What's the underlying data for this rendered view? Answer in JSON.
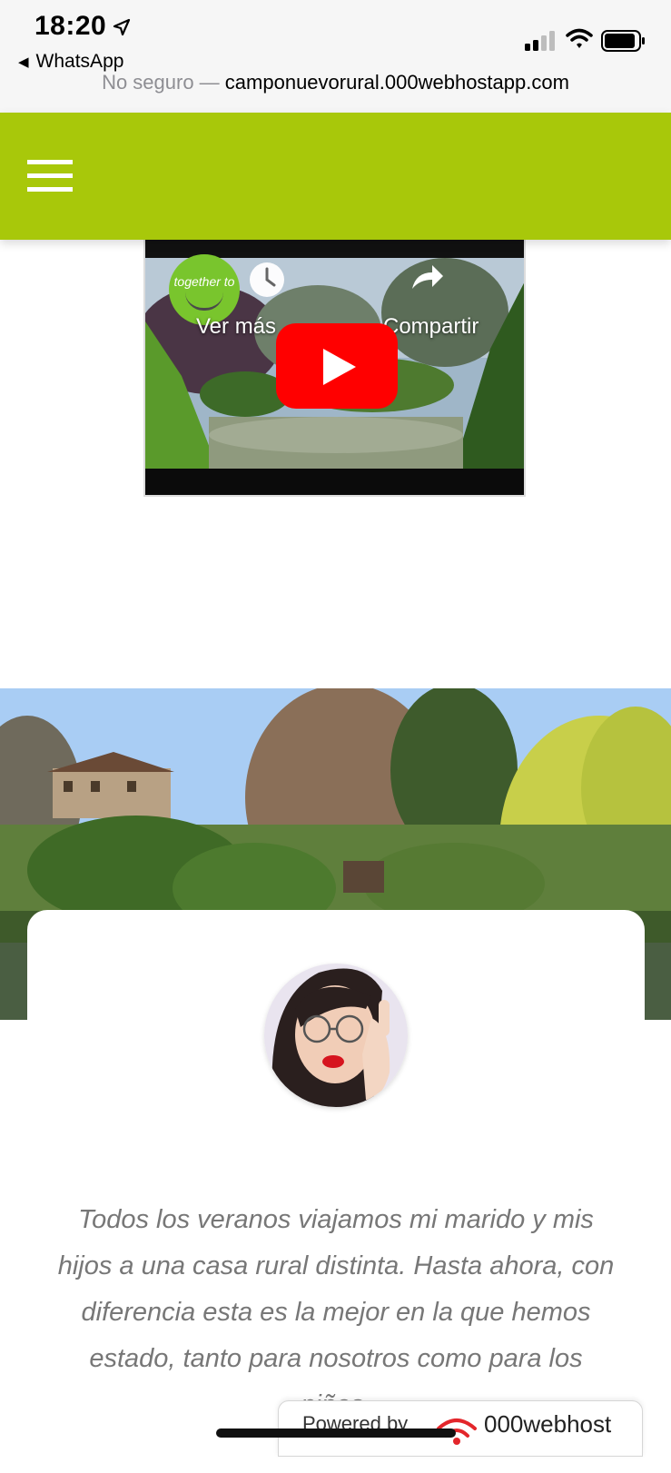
{
  "status_bar": {
    "time": "18:20",
    "back_app": "WhatsApp",
    "url_prefix": "No seguro — ",
    "url_host": "camponuevorural.000webhostapp.com"
  },
  "header": {
    "color": "#a8c80a",
    "menu_icon": "hamburger-menu-icon"
  },
  "video": {
    "channel_logo_text": "together to",
    "more_label": "Ver más",
    "share_label": "Compartir",
    "play_icon": "youtube-play-icon"
  },
  "testimonial": {
    "quote": "Todos los veranos viajamos mi marido y mis hijos a una casa rural distinta. Hasta ahora, con diferencia esta es la mejor en la que hemos estado, tanto para nosotros como para los niños."
  },
  "badge": {
    "powered": "Powered by",
    "name": "000webhost"
  }
}
